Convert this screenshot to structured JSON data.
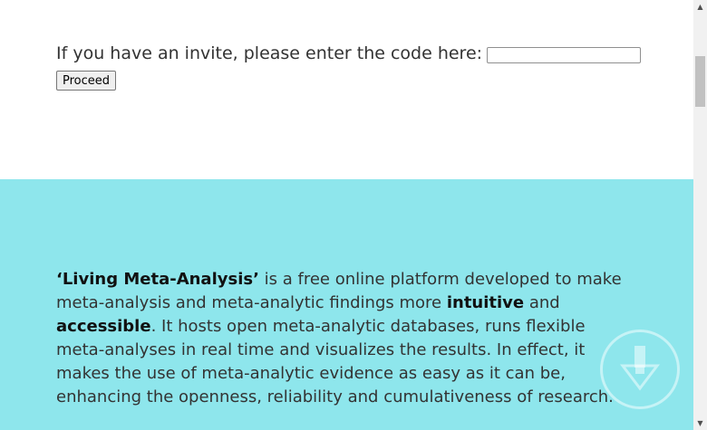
{
  "invite": {
    "prompt": "If you have an invite, please enter the code here:",
    "input_value": "",
    "button_label": "Proceed"
  },
  "about": {
    "lead": "‘Living Meta-Analysis’",
    "text1": " is a free online platform developed to make meta-analysis and meta-analytic findings more ",
    "strong1": "intuitive",
    "text2": " and ",
    "strong2": "accessible",
    "text3": ". It hosts open meta-analytic databases, runs flexible meta-analyses in real time and visualizes the results. In effect, it makes the use of meta-analytic evidence as easy as it can be, enhancing the openness, reliability and cumulativeness of research."
  },
  "icons": {
    "scroll_down": "arrow-down-circle-icon",
    "scroll_up_arrow": "▲",
    "scroll_down_arrow": "▼"
  },
  "colors": {
    "info_background": "#8ee6ec",
    "text": "#333333"
  }
}
